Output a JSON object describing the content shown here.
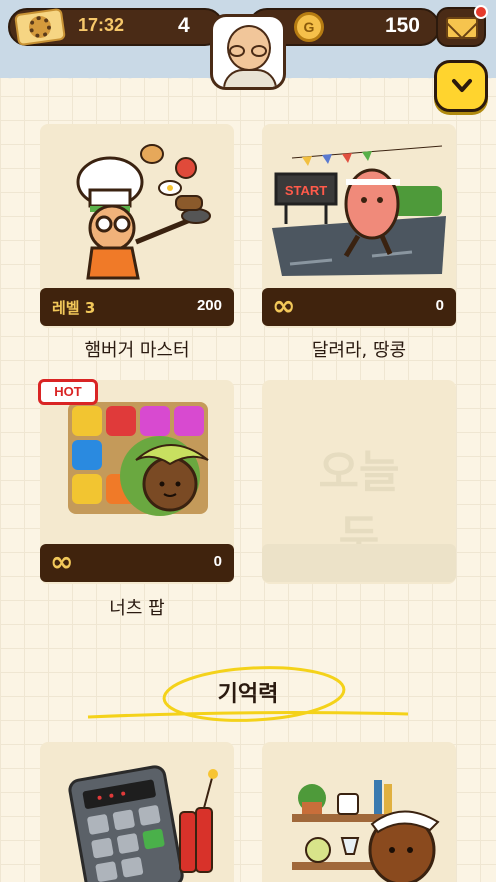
{
  "header": {
    "time": "17:32",
    "tickets": "4",
    "coin_symbol": "G",
    "coins": "150"
  },
  "games": [
    {
      "level": "레벨 3",
      "score": "200",
      "title": "햄버거 마스터"
    },
    {
      "level": "∞",
      "score": "0",
      "title": "달려라, 땅콩",
      "sign": "START"
    },
    {
      "level": "∞",
      "score": "0",
      "title": "너츠 팝",
      "badge": "HOT"
    },
    {
      "locked_logo": "오늘두"
    }
  ],
  "section": {
    "title": "기억력"
  },
  "colors": {
    "accent": "#ffd42e",
    "dark": "#40230d",
    "hot": "#d92424"
  }
}
